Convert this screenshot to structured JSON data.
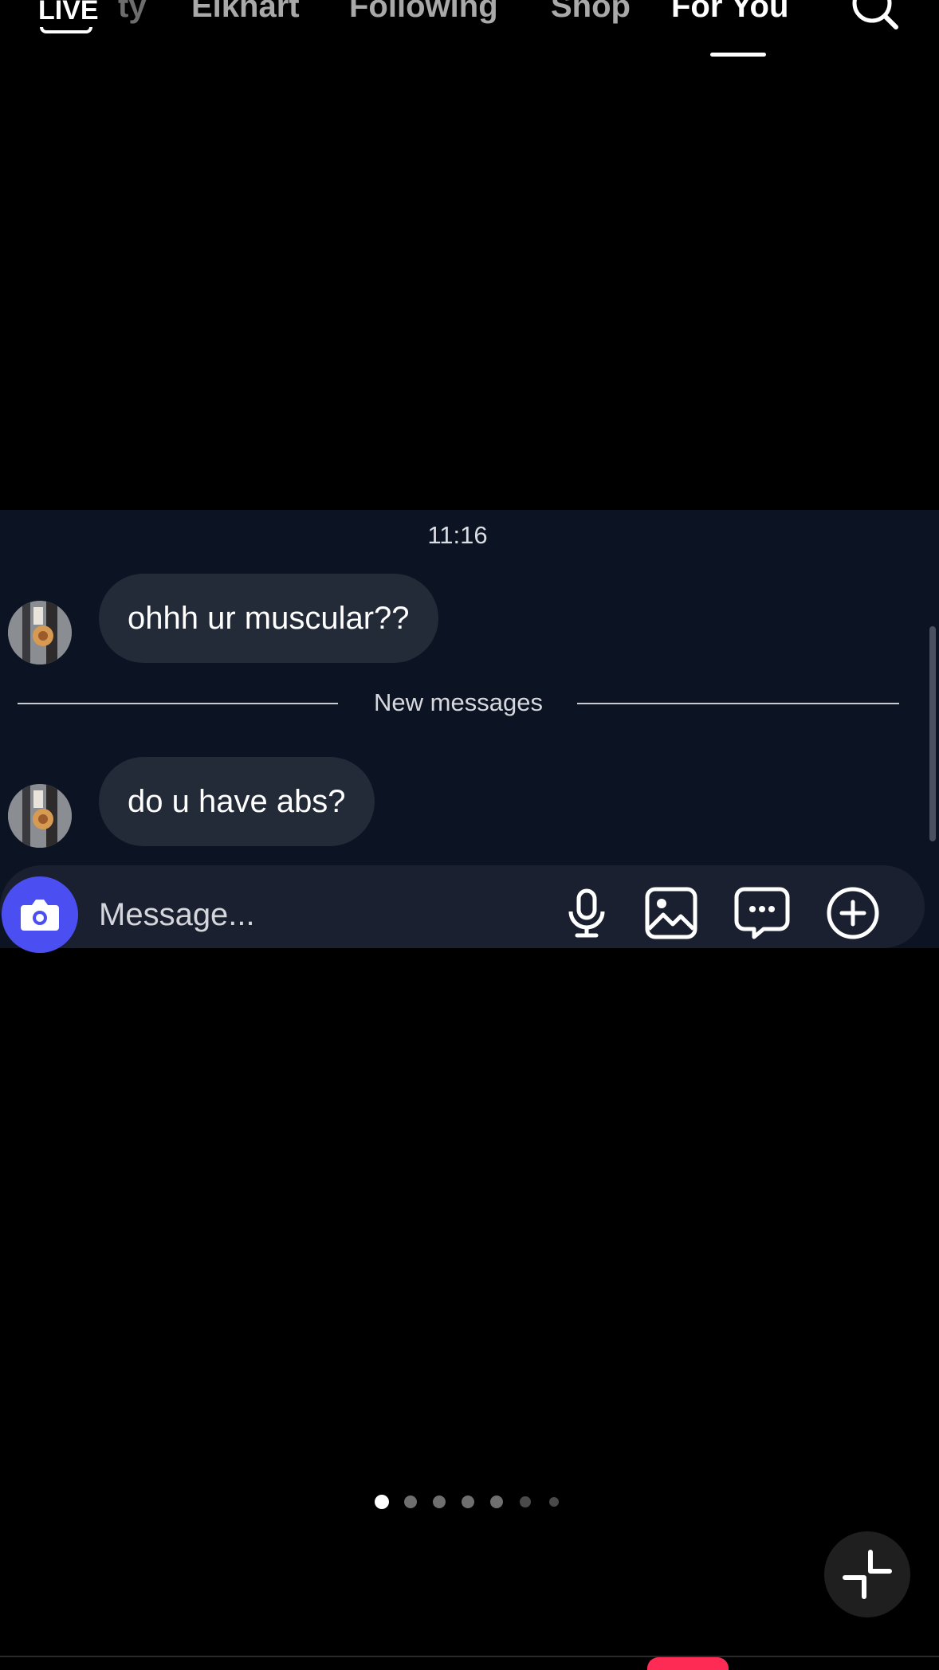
{
  "top_nav": {
    "live_label": "LIVE",
    "tabs": [
      {
        "label": "ty",
        "partial": true
      },
      {
        "label": "Elkhart"
      },
      {
        "label": "Following"
      },
      {
        "label": "Shop"
      },
      {
        "label": "For You",
        "active": true
      }
    ]
  },
  "chat": {
    "timestamp": "11:16",
    "messages": [
      {
        "text": "ohhh ur muscular??"
      },
      {
        "text": "do u have abs?"
      }
    ],
    "new_messages_label": "New messages"
  },
  "composer": {
    "placeholder": "Message...",
    "icons": [
      "camera-icon",
      "microphone-icon",
      "image-icon",
      "sticker-chat-icon",
      "plus-circle-icon"
    ]
  },
  "pager": {
    "count": 7,
    "active_index": 0
  },
  "colors": {
    "chat_bg": "#0c1322",
    "bubble_bg": "#232a38",
    "camera_button": "#4b4ff2",
    "badge": "#fe2c55"
  }
}
